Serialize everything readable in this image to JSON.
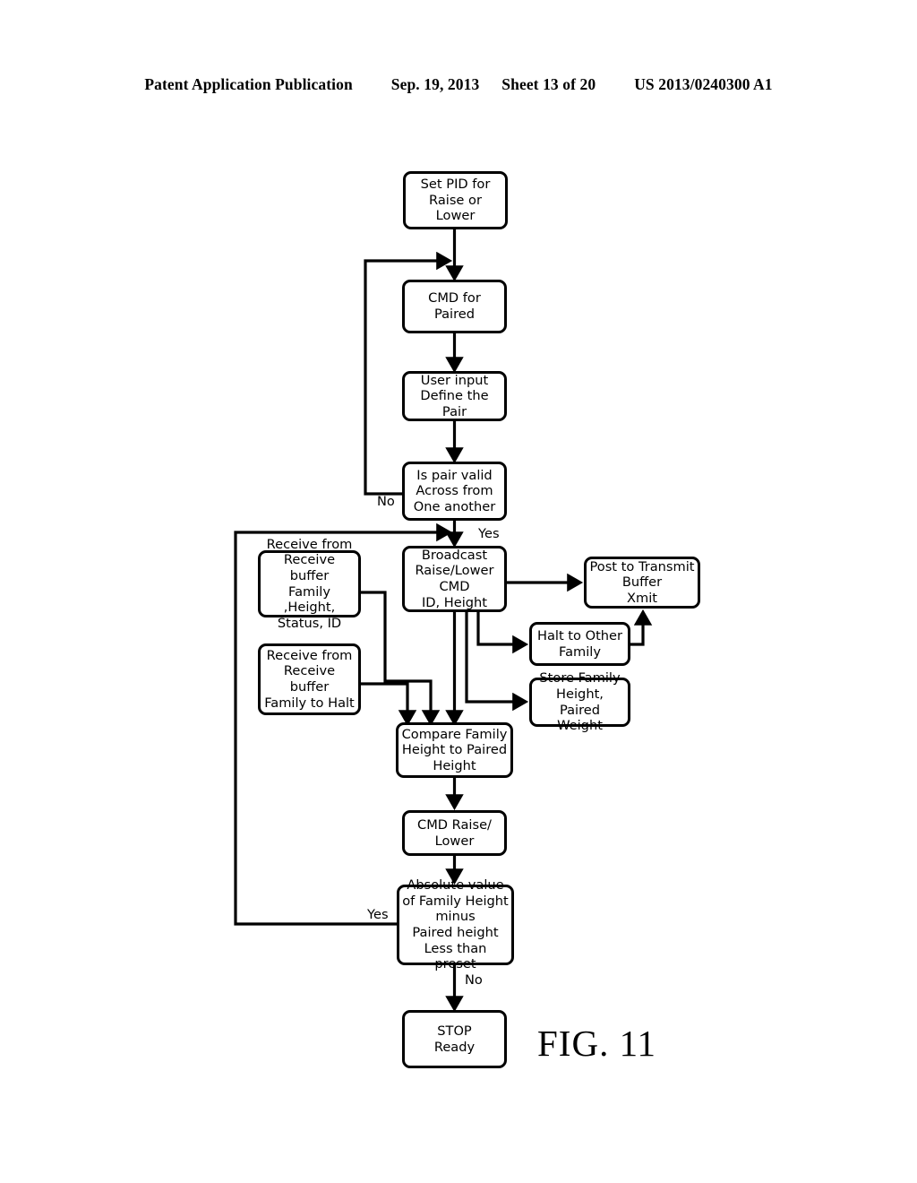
{
  "header": {
    "publication": "Patent Application Publication",
    "date": "Sep. 19, 2013",
    "sheet": "Sheet 13 of 20",
    "patent_number": "US 2013/0240300 A1"
  },
  "figure": {
    "caption": "FIG. 11"
  },
  "flowchart": {
    "type": "flowchart",
    "nodes": [
      {
        "id": "set_pid",
        "label": "Set PID for\nRaise or Lower"
      },
      {
        "id": "cmd_paired",
        "label": "CMD for Paired"
      },
      {
        "id": "user_input",
        "label": "User input\nDefine the Pair"
      },
      {
        "id": "is_valid",
        "label": "Is pair valid\nAcross from\nOne another"
      },
      {
        "id": "recv_family",
        "label": "Receive from\nReceive buffer\nFamily ,Height,\nStatus, ID"
      },
      {
        "id": "recv_halt",
        "label": "Receive from\nReceive buffer\nFamily to Halt"
      },
      {
        "id": "broadcast",
        "label": "Broadcast\nRaise/Lower\nCMD\nID, Height"
      },
      {
        "id": "post_xmit",
        "label": "Post to Transmit\nBuffer\nXmit"
      },
      {
        "id": "halt_other",
        "label": "Halt to Other\nFamily"
      },
      {
        "id": "store_fam",
        "label": "Store Family\nHeight, Paired\nWeight"
      },
      {
        "id": "compare",
        "label": "Compare Family\nHeight to Paired\nHeight"
      },
      {
        "id": "cmd_raise",
        "label": "CMD Raise/\nLower"
      },
      {
        "id": "abs_value",
        "label": "Absolute value\nof Family Height\nminus\nPaired height\nLess than preset"
      },
      {
        "id": "stop",
        "label": "STOP\nReady"
      }
    ],
    "edge_labels": {
      "no_valid": "No",
      "yes_valid": "Yes",
      "yes_abs": "Yes",
      "no_abs": "No"
    },
    "edges": [
      {
        "from": "set_pid",
        "to": "cmd_paired",
        "label": ""
      },
      {
        "from": "cmd_paired",
        "to": "user_input",
        "label": ""
      },
      {
        "from": "user_input",
        "to": "is_valid",
        "label": ""
      },
      {
        "from": "is_valid",
        "to": "cmd_paired",
        "label": "No"
      },
      {
        "from": "is_valid",
        "to": "broadcast",
        "label": "Yes"
      },
      {
        "from": "broadcast",
        "to": "post_xmit",
        "label": ""
      },
      {
        "from": "broadcast",
        "to": "halt_other",
        "label": ""
      },
      {
        "from": "broadcast",
        "to": "store_fam",
        "label": ""
      },
      {
        "from": "broadcast",
        "to": "compare",
        "label": ""
      },
      {
        "from": "halt_other",
        "to": "post_xmit",
        "label": ""
      },
      {
        "from": "recv_family",
        "to": "compare",
        "label": ""
      },
      {
        "from": "recv_halt",
        "to": "compare",
        "label": ""
      },
      {
        "from": "compare",
        "to": "cmd_raise",
        "label": ""
      },
      {
        "from": "cmd_raise",
        "to": "abs_value",
        "label": ""
      },
      {
        "from": "abs_value",
        "to": "broadcast",
        "label": "Yes"
      },
      {
        "from": "abs_value",
        "to": "stop",
        "label": "No"
      }
    ],
    "colors": {
      "stroke": "#000000",
      "fill": "#ffffff",
      "text": "#000000"
    }
  }
}
